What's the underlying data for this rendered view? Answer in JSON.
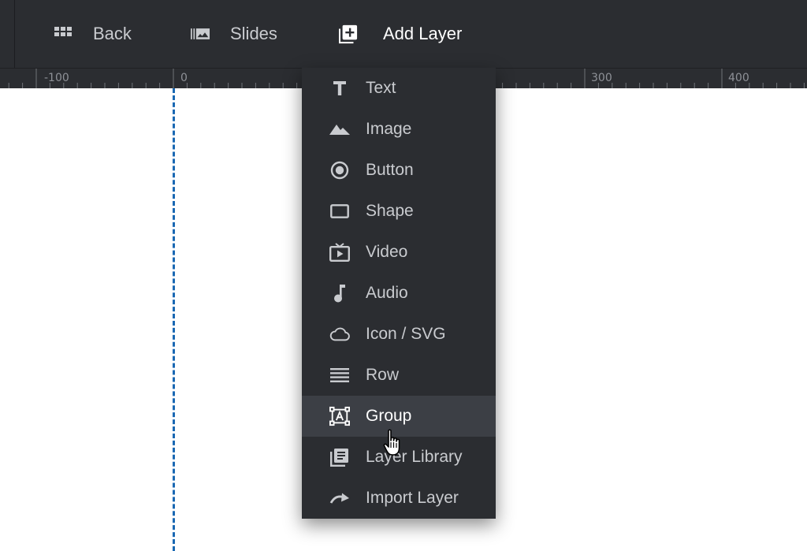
{
  "toolbar": {
    "back_label": "Back",
    "slides_label": "Slides",
    "add_layer_label": "Add Layer"
  },
  "ruler": {
    "labels": [
      "-100",
      "0",
      "300",
      "400"
    ]
  },
  "menu": {
    "items": [
      {
        "label": "Text",
        "icon": "text-icon"
      },
      {
        "label": "Image",
        "icon": "image-icon"
      },
      {
        "label": "Button",
        "icon": "button-icon"
      },
      {
        "label": "Shape",
        "icon": "shape-icon"
      },
      {
        "label": "Video",
        "icon": "video-icon"
      },
      {
        "label": "Audio",
        "icon": "audio-icon"
      },
      {
        "label": "Icon / SVG",
        "icon": "cloud-icon"
      },
      {
        "label": "Row",
        "icon": "row-icon"
      },
      {
        "label": "Group",
        "icon": "group-icon"
      },
      {
        "label": "Layer Library",
        "icon": "library-icon"
      },
      {
        "label": "Import Layer",
        "icon": "import-icon"
      }
    ],
    "hovered": "Group"
  },
  "colors": {
    "toolbar_bg": "#2b2d31",
    "menu_hover_bg": "#3c3f45",
    "guide": "#1a68b3",
    "text": "#c9cbcf"
  }
}
